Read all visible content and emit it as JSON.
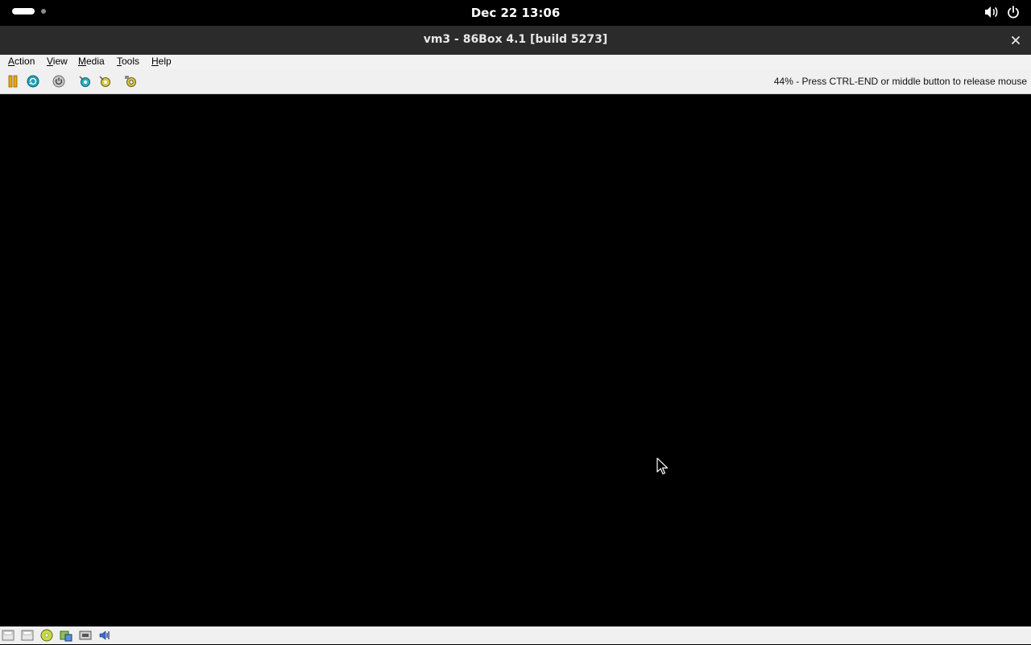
{
  "topbar": {
    "clock": "Dec 22  13:06",
    "icons": [
      "activities-indicator",
      "volume-icon",
      "power-icon"
    ]
  },
  "window": {
    "title": "vm3 - 86Box 4.1 [build 5273]",
    "close_icon": "close-icon"
  },
  "menubar": {
    "items": [
      "Action",
      "View",
      "Media",
      "Tools",
      "Help"
    ]
  },
  "toolbar": {
    "buttons": [
      "pause-icon",
      "ctrl-alt-del-icon",
      "power-reset-icon",
      "settings-icon",
      "settings-alt-icon",
      "screenshot-icon"
    ],
    "status": "44% - Press CTRL-END or middle button to release mouse"
  },
  "statusbar": {
    "icons": [
      "floppy-a-icon",
      "floppy-b-icon",
      "cdrom-icon",
      "hard-disk-icon",
      "network-icon",
      "sound-icon"
    ]
  },
  "colors": {
    "topbar": "#000000",
    "titlebar": "#2b2b2b",
    "menubar": "#f2f2f2",
    "toolbar": "#f0f0f0",
    "screen": "#000000"
  }
}
